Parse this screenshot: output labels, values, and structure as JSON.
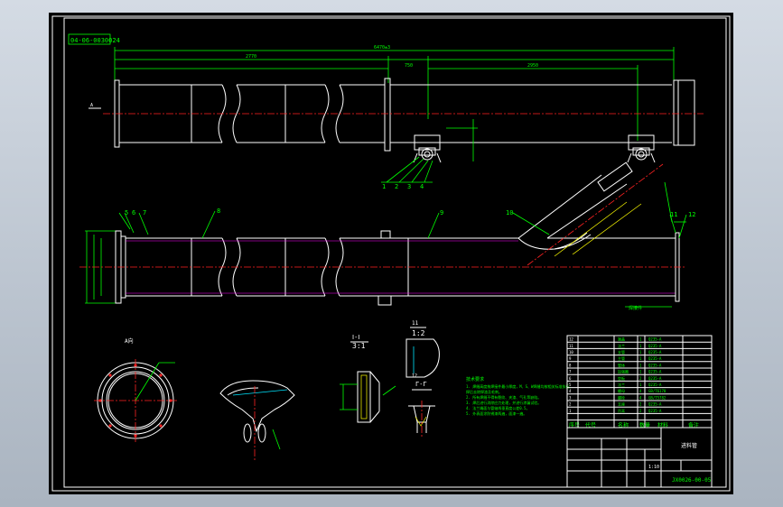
{
  "drawing": {
    "stamp": "04-06-0030024",
    "dims": {
      "overall_top": "6470±3",
      "top_left": "2770",
      "top_mid": "750",
      "top_right": "2950",
      "front_dim_a": "A"
    },
    "balloons": [
      "1",
      "2",
      "3",
      "4",
      "5",
      "6",
      "7",
      "8",
      "9",
      "10",
      "11",
      "12"
    ],
    "view_a_label": "A向",
    "section_label": "Ⅰ-Ⅰ",
    "scale_1": "3:1",
    "scale_2": "1:2",
    "section_b": "Γ-Γ",
    "weld_note": "焊接件",
    "tech_title": "技术要求",
    "tech_notes": [
      "1. 焊缝高度按焊接件最小厚度，M、S、W焊缝均按相关标准执行。",
      "   焊后去除焊渣及毛刺。",
      "2. 所有焊缝不得有裂纹、夹渣、气孔等缺陷。",
      "3. 焊后进行消除应力处理，并进行渗漏试验。",
      "4. 法兰端面与管轴线垂直度公差0.5。",
      "5. 外表面涂防锈漆两遍，面漆一遍。"
    ]
  },
  "bom": {
    "rows": [
      {
        "no": "12",
        "name": "端盖",
        "qty": "1",
        "mat": "Q235-A"
      },
      {
        "no": "11",
        "name": "法兰",
        "qty": "1",
        "mat": "Q235-A"
      },
      {
        "no": "10",
        "name": "支管",
        "qty": "1",
        "mat": "Q235-A"
      },
      {
        "no": "9",
        "name": "主管",
        "qty": "1",
        "mat": "Q235-A"
      },
      {
        "no": "8",
        "name": "管体",
        "qty": "1",
        "mat": "Q235-A"
      },
      {
        "no": "7",
        "name": "加强圈",
        "qty": "1",
        "mat": "Q235-A"
      },
      {
        "no": "6",
        "name": "垫板",
        "qty": "2",
        "mat": "Q235-A"
      },
      {
        "no": "5",
        "name": "法兰",
        "qty": "1",
        "mat": "Q235-A"
      },
      {
        "no": "4",
        "name": "螺母",
        "qty": "4",
        "mat": "GB/T6170"
      },
      {
        "no": "3",
        "name": "螺栓",
        "qty": "4",
        "mat": "GB/T5782"
      },
      {
        "no": "2",
        "name": "支座",
        "qty": "2",
        "mat": "Q235-A"
      },
      {
        "no": "1",
        "name": "吊耳",
        "qty": "2",
        "mat": "Q235-A"
      }
    ],
    "headers": [
      "序号",
      "代号",
      "名称",
      "数量",
      "材料",
      "备注"
    ],
    "footer_name": "进料管",
    "footer_code": "JX0026-00-05",
    "footer_scale": "1:10"
  }
}
